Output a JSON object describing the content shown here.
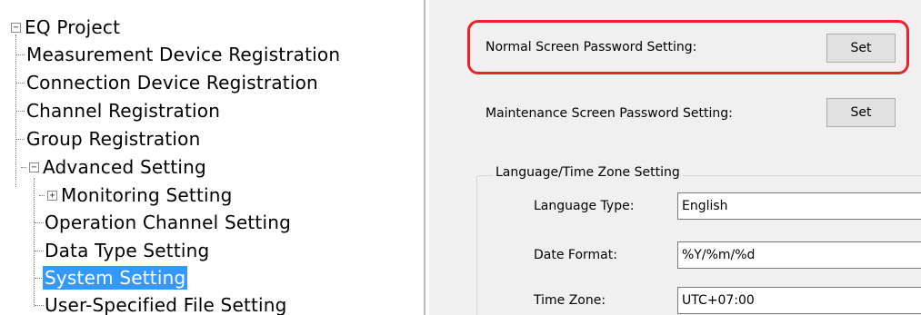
{
  "tree": {
    "root": {
      "label": "EQ Project",
      "expander": "−"
    },
    "items": [
      {
        "label": "Measurement Device Registration"
      },
      {
        "label": "Connection Device Registration"
      },
      {
        "label": "Channel Registration"
      },
      {
        "label": "Group Registration"
      },
      {
        "label": "Advanced Setting",
        "expander": "−"
      },
      {
        "label": "Monitoring Setting",
        "expander": "+"
      },
      {
        "label": "Operation Channel Setting"
      },
      {
        "label": "Data Type Setting"
      },
      {
        "label": "System Setting",
        "selected": true
      },
      {
        "label": "User-Specified File Setting"
      }
    ]
  },
  "settings": {
    "normal_password": {
      "label": "Normal Screen Password Setting:",
      "button": "Set"
    },
    "maintenance_password": {
      "label": "Maintenance Screen Password Setting:",
      "button": "Set"
    },
    "lang_group": {
      "title": "Language/Time Zone Setting",
      "language_type": {
        "label": "Language Type:",
        "value": "English"
      },
      "date_format": {
        "label": "Date Format:",
        "value": "%Y/%m/%d"
      },
      "time_zone": {
        "label": "Time Zone:",
        "value": "UTC+07:00"
      }
    }
  },
  "colors": {
    "highlight": "#e8242a",
    "selection": "#3399ff",
    "panel_bg": "#f0f0f0"
  }
}
